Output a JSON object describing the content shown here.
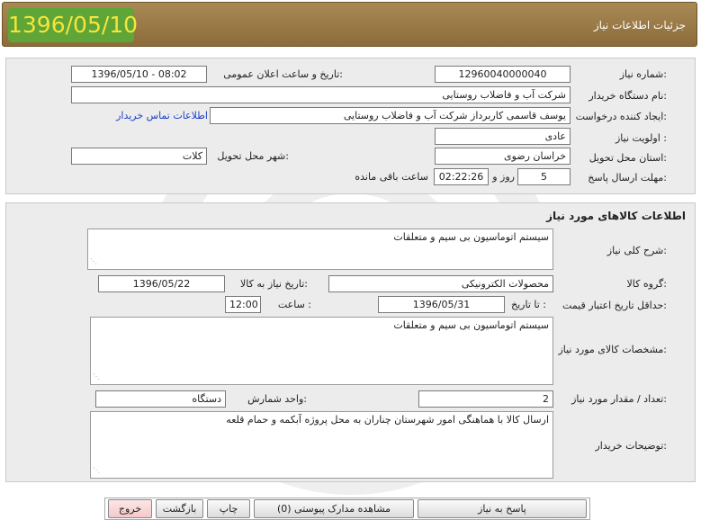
{
  "header": {
    "title": "جزئیات اطلاعات نیاز",
    "date_badge": "1396/05/10"
  },
  "info": {
    "need_number_label": "شماره نیاز:",
    "need_number": "1296004000004​0",
    "announce_label": "تاریخ و ساعت اعلان عمومی:",
    "announce_value": "1396/05/10 - 08:02",
    "buyer_org_label": "نام دستگاه خریدار:",
    "buyer_org": "شرکت آب و فاضلاب روستایی",
    "creator_label": "ایجاد کننده درخواست:",
    "creator": "یوسف  قاسمی کاربرداز شرکت آب و فاضلاب روستایی",
    "contact_link": "اطلاعات تماس خریدار",
    "priority_label": "اولویت نیاز :",
    "priority": "عادی",
    "province_label": "استان محل تحویل:",
    "province": "خراسان رضوی",
    "city_label": "شهر محل تحویل:",
    "city": "کلات",
    "deadline_label": "مهلت ارسال پاسخ:",
    "days": "5",
    "days_label": "روز و",
    "time_left": "02:22:26",
    "time_left_label": "ساعت باقی مانده"
  },
  "goods": {
    "section_title": "اطلاعات کالاهای مورد نیاز",
    "summary_label": "شرح کلی نیاز:",
    "summary": "سیستم اتوماسیون بی سیم و متعلقات",
    "group_label": "گروه کالا:",
    "group": "محصولات الکترونیکی",
    "need_date_label": "تاریخ نیاز به کالا:",
    "need_date": "1396/05/22",
    "min_validity_label": "حداقل تاریخ اعتبار قیمت:",
    "until_date_label": "تا تاریخ :",
    "until_date": "1396/05/31",
    "hour_label": "ساعت :",
    "hour": "12:00",
    "specs_label": "مشخصات کالای مورد نیاز:",
    "specs": "سیستم اتوماسیون بی سیم و متعلقات",
    "qty_label": "تعداد / مقدار مورد نیاز:",
    "qty": "2",
    "unit_label": "واحد شمارش:",
    "unit": "دستگاه",
    "buyer_notes_label": "توضیحات خریدار:",
    "buyer_notes": "ارسال کالا با هماهنگی امور شهرستان چناران به محل پروژه آبکمه و حمام قلعه"
  },
  "buttons": {
    "reply": "پاسخ به نیاز",
    "attachments": "مشاهده مدارک پیوستی (0)",
    "print": "چاپ",
    "back": "بازگشت",
    "exit": "خروج"
  }
}
